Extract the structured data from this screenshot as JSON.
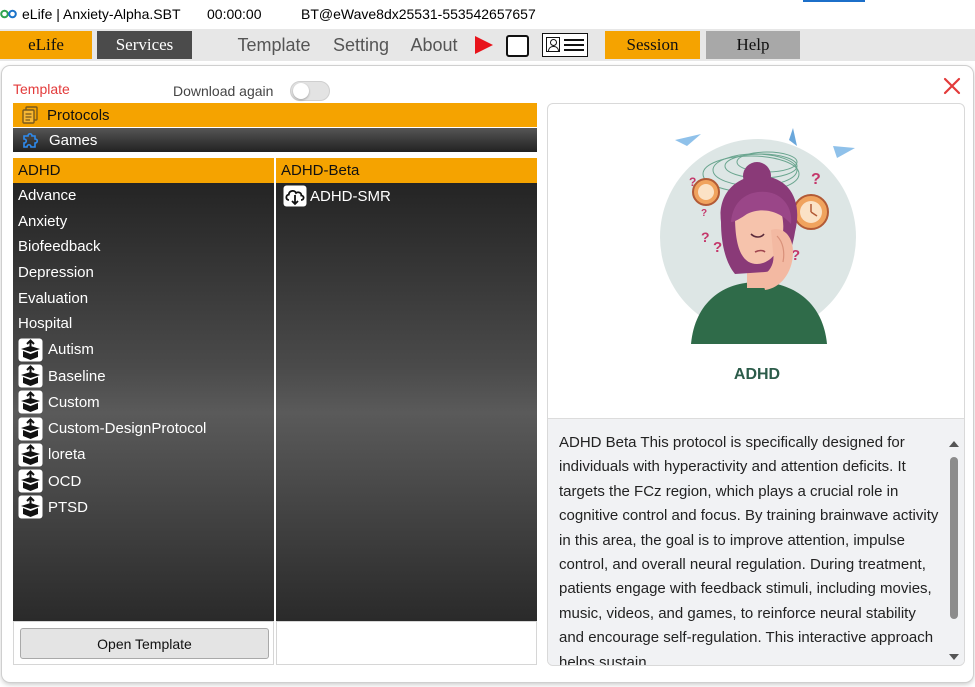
{
  "titlebar": {
    "app_title": "eLife | Anxiety-Alpha.SBT",
    "timer": "00:00:00",
    "device": "BT@eWave8dx25531-553542657657"
  },
  "menubar": {
    "elife": "eLife",
    "services": "Services",
    "template": "Template",
    "setting": "Setting",
    "about": "About",
    "session": "Session",
    "help": "Help"
  },
  "dialog": {
    "template_label": "Template",
    "download_again_label": "Download again",
    "download_again_on": false,
    "categories": [
      {
        "label": "Protocols",
        "icon": "clipboard-icon",
        "selected": true
      },
      {
        "label": "Games",
        "icon": "puzzle-icon",
        "selected": false
      }
    ],
    "left_list": {
      "header": "ADHD",
      "items": [
        "Advance",
        "Anxiety",
        "Biofeedback",
        "Depression",
        "Evaluation",
        "Hospital"
      ],
      "package_items": [
        "Autism",
        "Baseline",
        "Custom",
        "Custom-DesignProtocol",
        "loreta",
        "OCD",
        "PTSD"
      ]
    },
    "right_list": {
      "header": "ADHD-Beta",
      "items": [
        "ADHD-SMR"
      ]
    },
    "open_template_button": "Open Template",
    "preview": {
      "name": "ADHD",
      "description": "ADHD Beta This protocol is specifically designed for individuals with hyperactivity and attention deficits. It targets the FCz region, which plays a crucial role in cognitive control and focus. By training brainwave activity in this area, the goal is to improve attention, impulse control, and overall neural regulation. During treatment, patients engage with feedback stimuli, including movies, music, videos, and games, to reinforce neural stability and encourage self-regulation. This interactive approach helps sustain"
    }
  },
  "colors": {
    "accent_orange": "#f5a300",
    "dark_gray": "#4b4b4b",
    "play_red": "#e8131b",
    "close_red": "#e33b3b",
    "title_green": "#2c5c4a"
  }
}
